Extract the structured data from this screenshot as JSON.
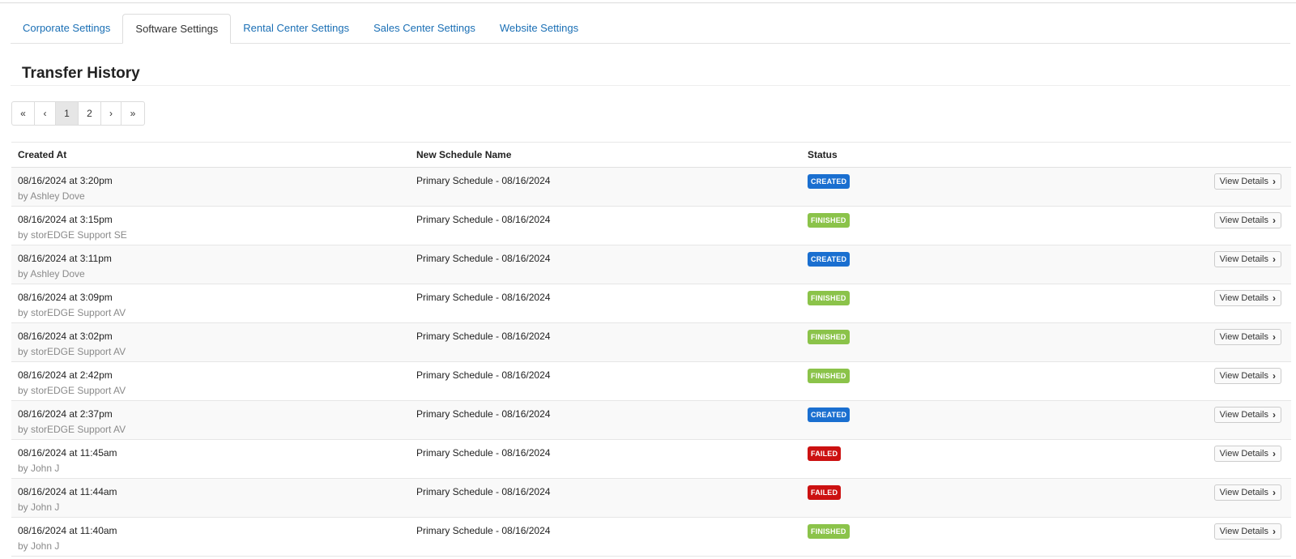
{
  "tabs": [
    {
      "label": "Corporate Settings",
      "active": false
    },
    {
      "label": "Software Settings",
      "active": true
    },
    {
      "label": "Rental Center Settings",
      "active": false
    },
    {
      "label": "Sales Center Settings",
      "active": false
    },
    {
      "label": "Website Settings",
      "active": false
    }
  ],
  "section_title": "Transfer History",
  "pagination": {
    "first": "«",
    "prev": "‹",
    "pages": [
      "1",
      "2"
    ],
    "current": "1",
    "next": "›",
    "last": "»"
  },
  "table": {
    "headers": {
      "created_at": "Created At",
      "schedule_name": "New Schedule Name",
      "status": "Status"
    },
    "view_details_label": "View Details",
    "rows": [
      {
        "created": "08/16/2024 at 3:20pm",
        "by": "by Ashley Dove",
        "schedule": "Primary Schedule - 08/16/2024",
        "status": "CREATED"
      },
      {
        "created": "08/16/2024 at 3:15pm",
        "by": "by storEDGE Support SE",
        "schedule": "Primary Schedule - 08/16/2024",
        "status": "FINISHED"
      },
      {
        "created": "08/16/2024 at 3:11pm",
        "by": "by Ashley Dove",
        "schedule": "Primary Schedule - 08/16/2024",
        "status": "CREATED"
      },
      {
        "created": "08/16/2024 at 3:09pm",
        "by": "by storEDGE Support AV",
        "schedule": "Primary Schedule - 08/16/2024",
        "status": "FINISHED"
      },
      {
        "created": "08/16/2024 at 3:02pm",
        "by": "by storEDGE Support AV",
        "schedule": "Primary Schedule - 08/16/2024",
        "status": "FINISHED"
      },
      {
        "created": "08/16/2024 at 2:42pm",
        "by": "by storEDGE Support AV",
        "schedule": "Primary Schedule - 08/16/2024",
        "status": "FINISHED"
      },
      {
        "created": "08/16/2024 at 2:37pm",
        "by": "by storEDGE Support AV",
        "schedule": "Primary Schedule - 08/16/2024",
        "status": "CREATED"
      },
      {
        "created": "08/16/2024 at 11:45am",
        "by": "by John J",
        "schedule": "Primary Schedule - 08/16/2024",
        "status": "FAILED"
      },
      {
        "created": "08/16/2024 at 11:44am",
        "by": "by John J",
        "schedule": "Primary Schedule - 08/16/2024",
        "status": "FAILED"
      },
      {
        "created": "08/16/2024 at 11:40am",
        "by": "by John J",
        "schedule": "Primary Schedule - 08/16/2024",
        "status": "FINISHED"
      }
    ]
  },
  "colors": {
    "link": "#1a6fb5",
    "created": "#1a6fd0",
    "finished": "#8bc34a",
    "failed": "#cc1111"
  },
  "icons": {
    "view_details": "chevron-right-icon"
  }
}
